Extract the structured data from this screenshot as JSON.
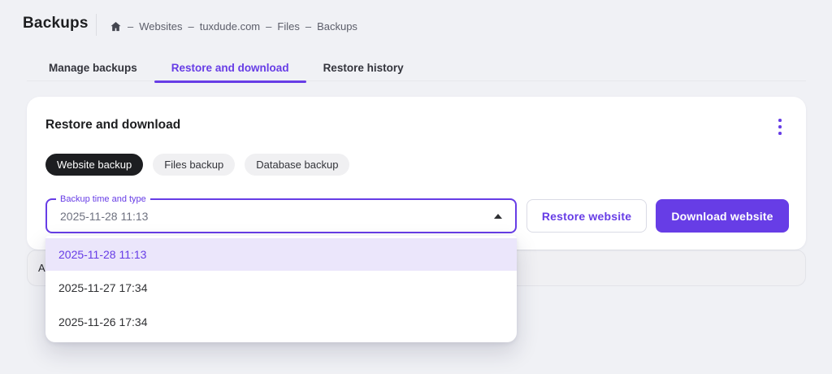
{
  "colors": {
    "brand": "#673de6",
    "page_bg": "#f0f1f5",
    "chip_dark_bg": "#1d1e21",
    "selected_option_bg": "#ebe6fb"
  },
  "header": {
    "title": "Backups"
  },
  "breadcrumb": {
    "separator": "–",
    "items": [
      "Websites",
      "tuxdude.com",
      "Files",
      "Backups"
    ]
  },
  "tabs": [
    {
      "label": "Manage backups",
      "active": false
    },
    {
      "label": "Restore and download",
      "active": true
    },
    {
      "label": "Restore history",
      "active": false
    }
  ],
  "card": {
    "title": "Restore and download",
    "chips": [
      {
        "label": "Website backup",
        "selected": true
      },
      {
        "label": "Files backup",
        "selected": false
      },
      {
        "label": "Database backup",
        "selected": false
      }
    ],
    "backup_field": {
      "label": "Backup time and type",
      "value": "2025-11-28 11:13",
      "state": "open"
    },
    "restore_button": "Restore website",
    "download_button": "Download website"
  },
  "dropdown_options": [
    {
      "label": "2025-11-28 11:13",
      "selected": true
    },
    {
      "label": "2025-11-27 17:34",
      "selected": false
    },
    {
      "label": "2025-11-26 17:34",
      "selected": false
    }
  ],
  "collapsed_row": {
    "visible_text": "A"
  }
}
